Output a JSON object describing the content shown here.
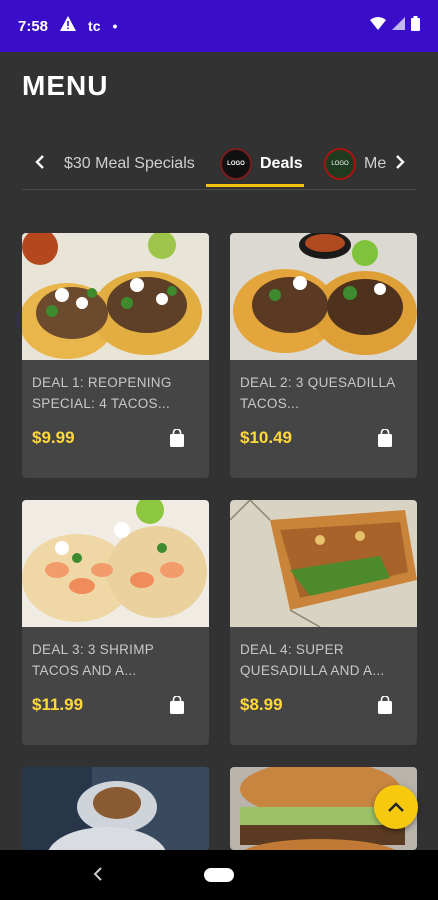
{
  "status_bar": {
    "time": "7:58",
    "carrier_glyph": "tc",
    "dot": "•",
    "icons": [
      "warning-icon",
      "wifi-icon",
      "signal-icon",
      "battery-icon"
    ]
  },
  "page_title": "MENU",
  "tabs": {
    "items": [
      {
        "label": "$30 Meal Specials"
      },
      {
        "label": "Deals",
        "selected": true
      },
      {
        "label": "Mexican Combos"
      }
    ],
    "more_label_visible": "Me",
    "accent": "#f4c20d"
  },
  "products": [
    {
      "title": "DEAL 1: REOPENING SPECIAL: 4 TACOS...",
      "price": "$9.99"
    },
    {
      "title": "DEAL 2: 3 QUESADILLA TACOS...",
      "price": "$10.49"
    },
    {
      "title": "DEAL 3: 3 SHRIMP TACOS AND A...",
      "price": "$11.99"
    },
    {
      "title": "DEAL 4: SUPER QUESADILLA AND A...",
      "price": "$8.99"
    }
  ],
  "colors": {
    "status_bar": "#3a0ec8",
    "background": "#323232",
    "card": "#454545",
    "price": "#ffd83a",
    "fab": "#f6c90e"
  }
}
